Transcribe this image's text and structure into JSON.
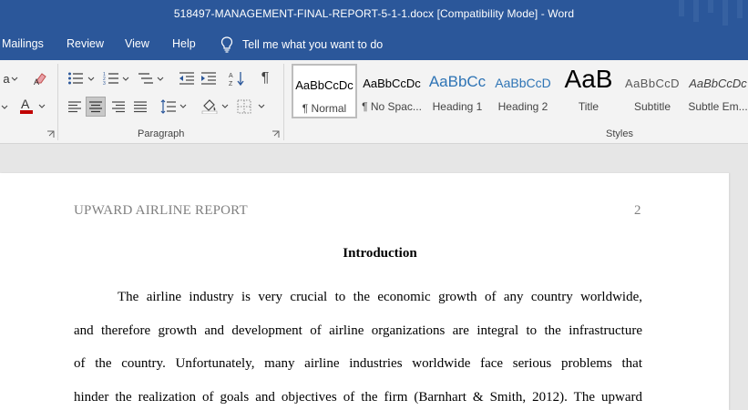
{
  "window": {
    "title": "518497-MANAGEMENT-FINAL-REPORT-5-1-1.docx  [Compatibility Mode]  -  Word"
  },
  "menu": {
    "items": [
      {
        "label": "Mailings"
      },
      {
        "label": "Review"
      },
      {
        "label": "View"
      },
      {
        "label": "Help"
      }
    ],
    "tell_me": "Tell me what you want to do",
    "tell_me_icon": "lightbulb-icon"
  },
  "ribbon": {
    "groups": {
      "paragraph": "Paragraph",
      "styles": "Styles"
    },
    "font_partial_label": "a",
    "font_color": "#c00000",
    "icons": [
      "font-dropdown-icon",
      "clear-formatting-icon",
      "font-color-icon",
      "bullets-icon",
      "numbering-icon",
      "multilevel-list-icon",
      "decrease-indent-icon",
      "increase-indent-icon",
      "sort-icon",
      "show-formatting-marks-icon",
      "align-left-icon",
      "align-center-icon",
      "align-right-icon",
      "justify-icon",
      "line-spacing-icon",
      "shading-icon",
      "borders-icon"
    ],
    "styles": [
      {
        "sample": "AaBbCcDc",
        "name": "¶ Normal",
        "selected": true
      },
      {
        "sample": "AaBbCcDc",
        "name": "¶ No Spac..."
      },
      {
        "sample": "AaBbCc",
        "name": "Heading 1"
      },
      {
        "sample": "AaBbCcD",
        "name": "Heading 2"
      },
      {
        "sample": "AaB",
        "name": "Title"
      },
      {
        "sample": "AaBbCcD",
        "name": "Subtitle"
      },
      {
        "sample": "AaBbCcDc",
        "name": "Subtle Em..."
      }
    ]
  },
  "document": {
    "header": "UPWARD AIRLINE REPORT",
    "page_number": "2",
    "heading": "Introduction",
    "lines": [
      "The airline industry is very crucial to the economic growth of any country worldwide,",
      "and therefore growth and development of airline organizations are integral to the infrastructure",
      "of the country. Unfortunately, many airline industries worldwide face serious problems that",
      "hinder the realization of goals and objectives of the firm (Barnhart & Smith, 2012). The upward"
    ]
  },
  "colors": {
    "word_blue": "#2b579a",
    "ribbon_bg": "#f3f3f3",
    "page_bg": "#ffffff",
    "header_gray": "#808080",
    "heading1_blue": "#2e74b5"
  }
}
